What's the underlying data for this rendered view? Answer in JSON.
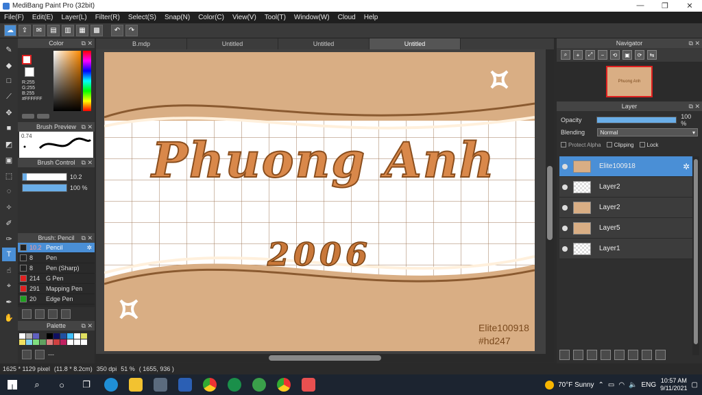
{
  "window": {
    "title": "MediBang Paint Pro (32bit)",
    "min": "—",
    "max": "❐",
    "close": "✕"
  },
  "menu": [
    "File(F)",
    "Edit(E)",
    "Layer(L)",
    "Filter(R)",
    "Select(S)",
    "Snap(N)",
    "Color(C)",
    "View(V)",
    "Tool(T)",
    "Window(W)",
    "Cloud",
    "Help"
  ],
  "tabs": [
    "B.mdp",
    "Untitled",
    "Untitled",
    "Untitled"
  ],
  "color_panel": {
    "title": "Color",
    "r": "R:255",
    "g": "G:255",
    "b": "B:255",
    "hex": "#FFFFFF"
  },
  "brush_preview": {
    "title": "Brush Preview",
    "size": "0.74"
  },
  "brush_control": {
    "title": "Brush Control",
    "size_value": "10.2",
    "opacity_value": "100 %",
    "size_fraction": 0.1,
    "opacity_fraction": 1.0
  },
  "brush_panel": {
    "title": "Brush: Pencil",
    "items": [
      {
        "num": "10.2",
        "name": "Pencil",
        "color": "#222222",
        "selected": true
      },
      {
        "num": "8",
        "name": "Pen",
        "color": "#222222"
      },
      {
        "num": "8",
        "name": "Pen (Sharp)",
        "color": "#222222"
      },
      {
        "num": "214",
        "name": "G Pen",
        "color": "#e02020"
      },
      {
        "num": "291",
        "name": "Mapping Pen",
        "color": "#e02020"
      },
      {
        "num": "20",
        "name": "Edge Pen",
        "color": "#20a020"
      }
    ]
  },
  "palette": {
    "title": "Palette",
    "footer": "---",
    "colors": [
      "#ffffff",
      "#b0b0b0",
      "#6060c0",
      "#303030",
      "#000000",
      "#101060",
      "#2050a0",
      "#40c0ff",
      "#ffffff",
      "#e0e060",
      "#f0e060",
      "#80d0f0",
      "#80e080",
      "#60a060",
      "#e08080",
      "#d04040",
      "#c02060",
      "#ffffff",
      "#ffffff",
      "#ffffff"
    ]
  },
  "artwork": {
    "title": "Phuong Anh",
    "year": "2006",
    "signature_line1": "Elite100918",
    "signature_line2": "#hd247"
  },
  "navigator": {
    "title": "Navigator",
    "thumb_text": "Phuong Anh"
  },
  "layer_panel": {
    "title": "Layer",
    "opacity_label": "Opacity",
    "opacity_value": "100 %",
    "blending_label": "Blending",
    "blending_value": "Normal",
    "protect_alpha": "Protect Alpha",
    "clipping": "Clipping",
    "lock": "Lock",
    "layers": [
      {
        "name": "Elite100918",
        "selected": true,
        "art": true
      },
      {
        "name": "Layer2",
        "art": false
      },
      {
        "name": "Layer2",
        "art": true
      },
      {
        "name": "Layer5",
        "art": true
      },
      {
        "name": "Layer1",
        "art": false
      }
    ]
  },
  "status": {
    "size": "1625 * 1129 pixel",
    "physical": "(11.8 * 8.2cm)",
    "dpi": "350 dpi",
    "zoom": "51 %",
    "coords": "( 1655, 936 )"
  },
  "taskbar": {
    "weather": "70°F  Sunny",
    "lang": "ENG",
    "time": "10:57 AM",
    "date": "9/11/2021"
  }
}
